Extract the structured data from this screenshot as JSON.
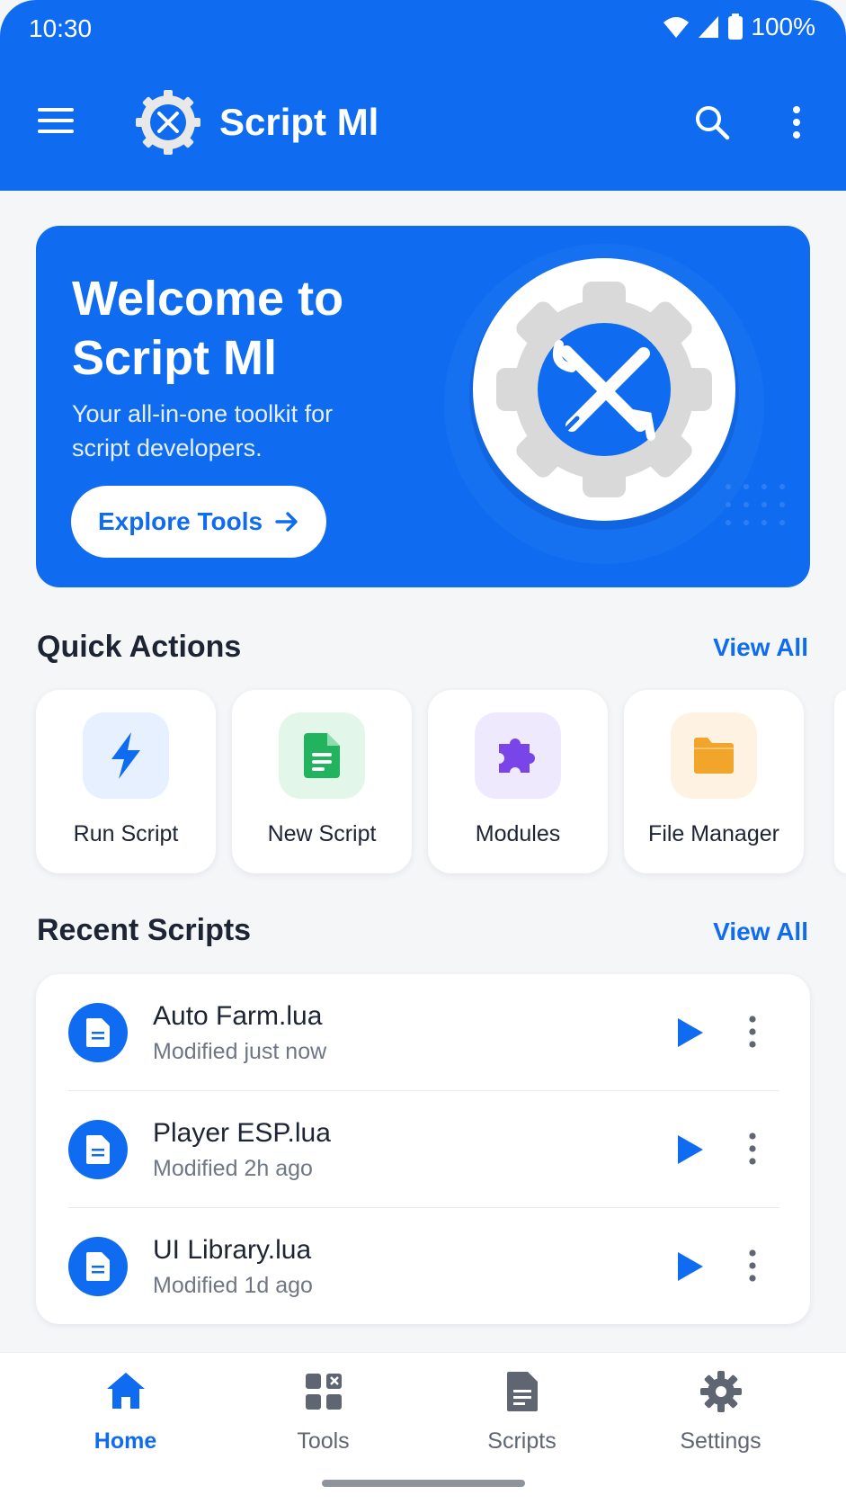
{
  "status_bar": {
    "time": "10:30",
    "battery": "100%"
  },
  "toolbar": {
    "title": "Script Ml"
  },
  "hero": {
    "title": "Welcome to Script Ml",
    "subtitle": "Your all-in-one toolkit for script developers.",
    "button_label": "Explore Tools"
  },
  "quick_actions": {
    "title": "Quick Actions",
    "view_all": "View All",
    "items": [
      {
        "label": "Run Script",
        "icon": "lightning-icon",
        "color": "#0f6cf0",
        "bg": "#e7f0ff"
      },
      {
        "label": "New Script",
        "icon": "document-icon",
        "color": "#22b35e",
        "bg": "#e3f6ea"
      },
      {
        "label": "Modules",
        "icon": "puzzle-icon",
        "color": "#7a45e8",
        "bg": "#efe9fd"
      },
      {
        "label": "File Manager",
        "icon": "folder-icon",
        "color": "#f2a52b",
        "bg": "#fef3e2"
      }
    ]
  },
  "recent_scripts": {
    "title": "Recent Scripts",
    "view_all": "View All",
    "items": [
      {
        "name": "Auto Farm.lua",
        "modified": "Modified just now"
      },
      {
        "name": "Player ESP.lua",
        "modified": "Modified 2h ago"
      },
      {
        "name": "UI Library.lua",
        "modified": "Modified 1d ago"
      }
    ]
  },
  "bottom_nav": {
    "items": [
      {
        "label": "Home",
        "icon": "home-icon",
        "active": true
      },
      {
        "label": "Tools",
        "icon": "grid-icon",
        "active": false
      },
      {
        "label": "Scripts",
        "icon": "document-icon",
        "active": false
      },
      {
        "label": "Settings",
        "icon": "gear-icon",
        "active": false
      }
    ]
  },
  "colors": {
    "primary": "#0f6cf0",
    "background": "#f5f6f8",
    "text": "#1d2433",
    "muted": "#6f7684"
  }
}
